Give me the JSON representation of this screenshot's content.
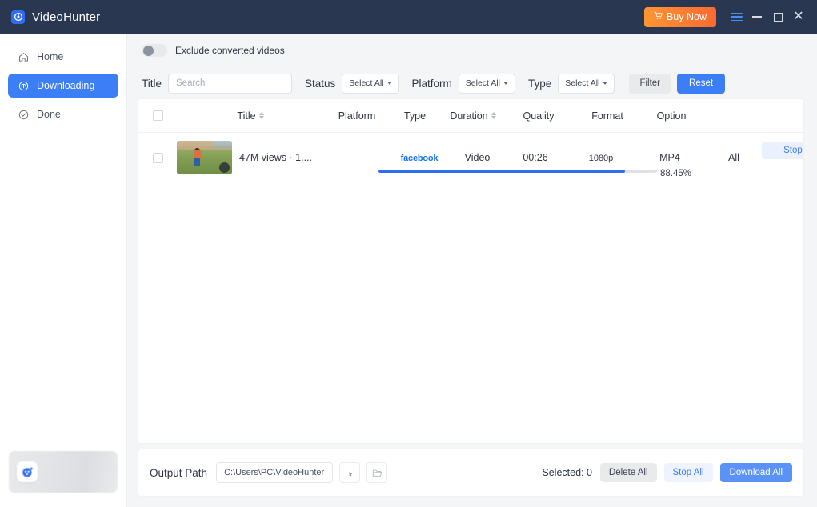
{
  "window": {
    "app_name": "VideoHunter",
    "logo_icon": "target-logo-icon",
    "buy_now_label": "Buy Now",
    "cart_icon": "cart-icon",
    "menu_icon": "hamburger-menu-icon",
    "minimize_icon": "minimize-icon",
    "maximize_icon": "maximize-icon",
    "close_icon": "close-icon",
    "titlebar_color": "#293751",
    "accent_color": "#3b7ef5",
    "buy_gradient_from": "#ff9533",
    "buy_gradient_to": "#fb6a32"
  },
  "sidebar": {
    "items": [
      {
        "label": "Home",
        "icon": "home-icon",
        "active": false
      },
      {
        "label": "Downloading",
        "icon": "download-cloud-icon",
        "active": true
      },
      {
        "label": "Done",
        "icon": "check-circle-icon",
        "active": false
      }
    ],
    "promo": {
      "icon": "app-promo-icon"
    }
  },
  "filters": {
    "exclude_toggle_label": "Exclude converted videos",
    "exclude_toggle_on": false,
    "title_label": "Title",
    "search_placeholder": "Search",
    "search_value": "",
    "status_label": "Status",
    "status_value": "Select All",
    "platform_label": "Platform",
    "platform_value": "Select All",
    "type_label": "Type",
    "type_value": "Select All",
    "filter_button": "Filter",
    "reset_button": "Reset"
  },
  "table": {
    "columns": {
      "title": "Title",
      "platform": "Platform",
      "type": "Type",
      "duration": "Duration",
      "quality": "Quality",
      "format": "Format",
      "option": "Option"
    },
    "rows": [
      {
        "title": "47M views · 1....",
        "platform": "facebook",
        "type": "Video",
        "duration": "00:26",
        "quality": "1080p",
        "format": "MP4",
        "option": "All",
        "progress_pct": 88.45,
        "progress_label": "88.45%",
        "action_label": "Stop",
        "selected": false
      }
    ]
  },
  "footer": {
    "output_path_label": "Output Path",
    "output_path_value": "C:\\Users\\PC\\VideoHunter",
    "pick_folder_icon": "cursor-select-icon",
    "open_folder_icon": "folder-open-icon",
    "selected_text": "Selected: 0",
    "delete_all_label": "Delete All",
    "stop_all_label": "Stop All",
    "download_all_label": "Download All"
  }
}
